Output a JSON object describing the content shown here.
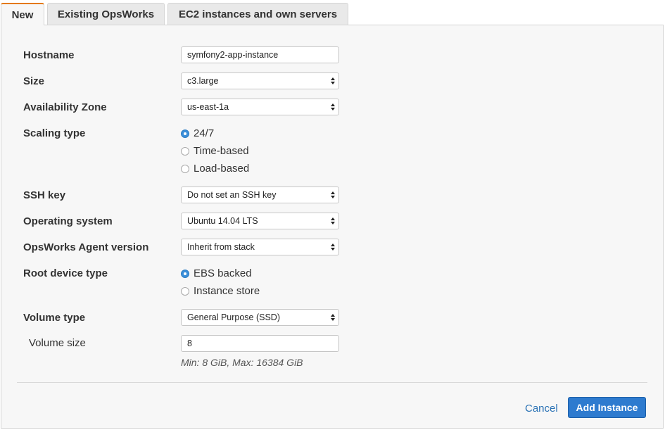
{
  "tabs": [
    {
      "label": "New",
      "active": true
    },
    {
      "label": "Existing OpsWorks",
      "active": false
    },
    {
      "label": "EC2 instances and own servers",
      "active": false
    }
  ],
  "form": {
    "hostname": {
      "label": "Hostname",
      "value": "symfony2-app-instance"
    },
    "size": {
      "label": "Size",
      "value": "c3.large"
    },
    "availability_zone": {
      "label": "Availability Zone",
      "value": "us-east-1a"
    },
    "scaling_type": {
      "label": "Scaling type",
      "options": [
        {
          "label": "24/7",
          "selected": true
        },
        {
          "label": "Time-based",
          "selected": false
        },
        {
          "label": "Load-based",
          "selected": false
        }
      ]
    },
    "ssh_key": {
      "label": "SSH key",
      "value": "Do not set an SSH key"
    },
    "operating_system": {
      "label": "Operating system",
      "value": "Ubuntu 14.04 LTS"
    },
    "agent_version": {
      "label": "OpsWorks Agent version",
      "value": "Inherit from stack"
    },
    "root_device_type": {
      "label": "Root device type",
      "options": [
        {
          "label": "EBS backed",
          "selected": true
        },
        {
          "label": "Instance store",
          "selected": false
        }
      ]
    },
    "volume_type": {
      "label": "Volume type",
      "value": "General Purpose (SSD)"
    },
    "volume_size": {
      "label": "Volume size",
      "value": "8",
      "hint": "Min: 8 GiB, Max: 16384 GiB"
    }
  },
  "actions": {
    "cancel_label": "Cancel",
    "add_label": "Add Instance"
  },
  "colors": {
    "accent_tab": "#e47911",
    "primary_button": "#2e7bcf",
    "link": "#2a72b5",
    "radio_selected": "#3b8fd9"
  }
}
